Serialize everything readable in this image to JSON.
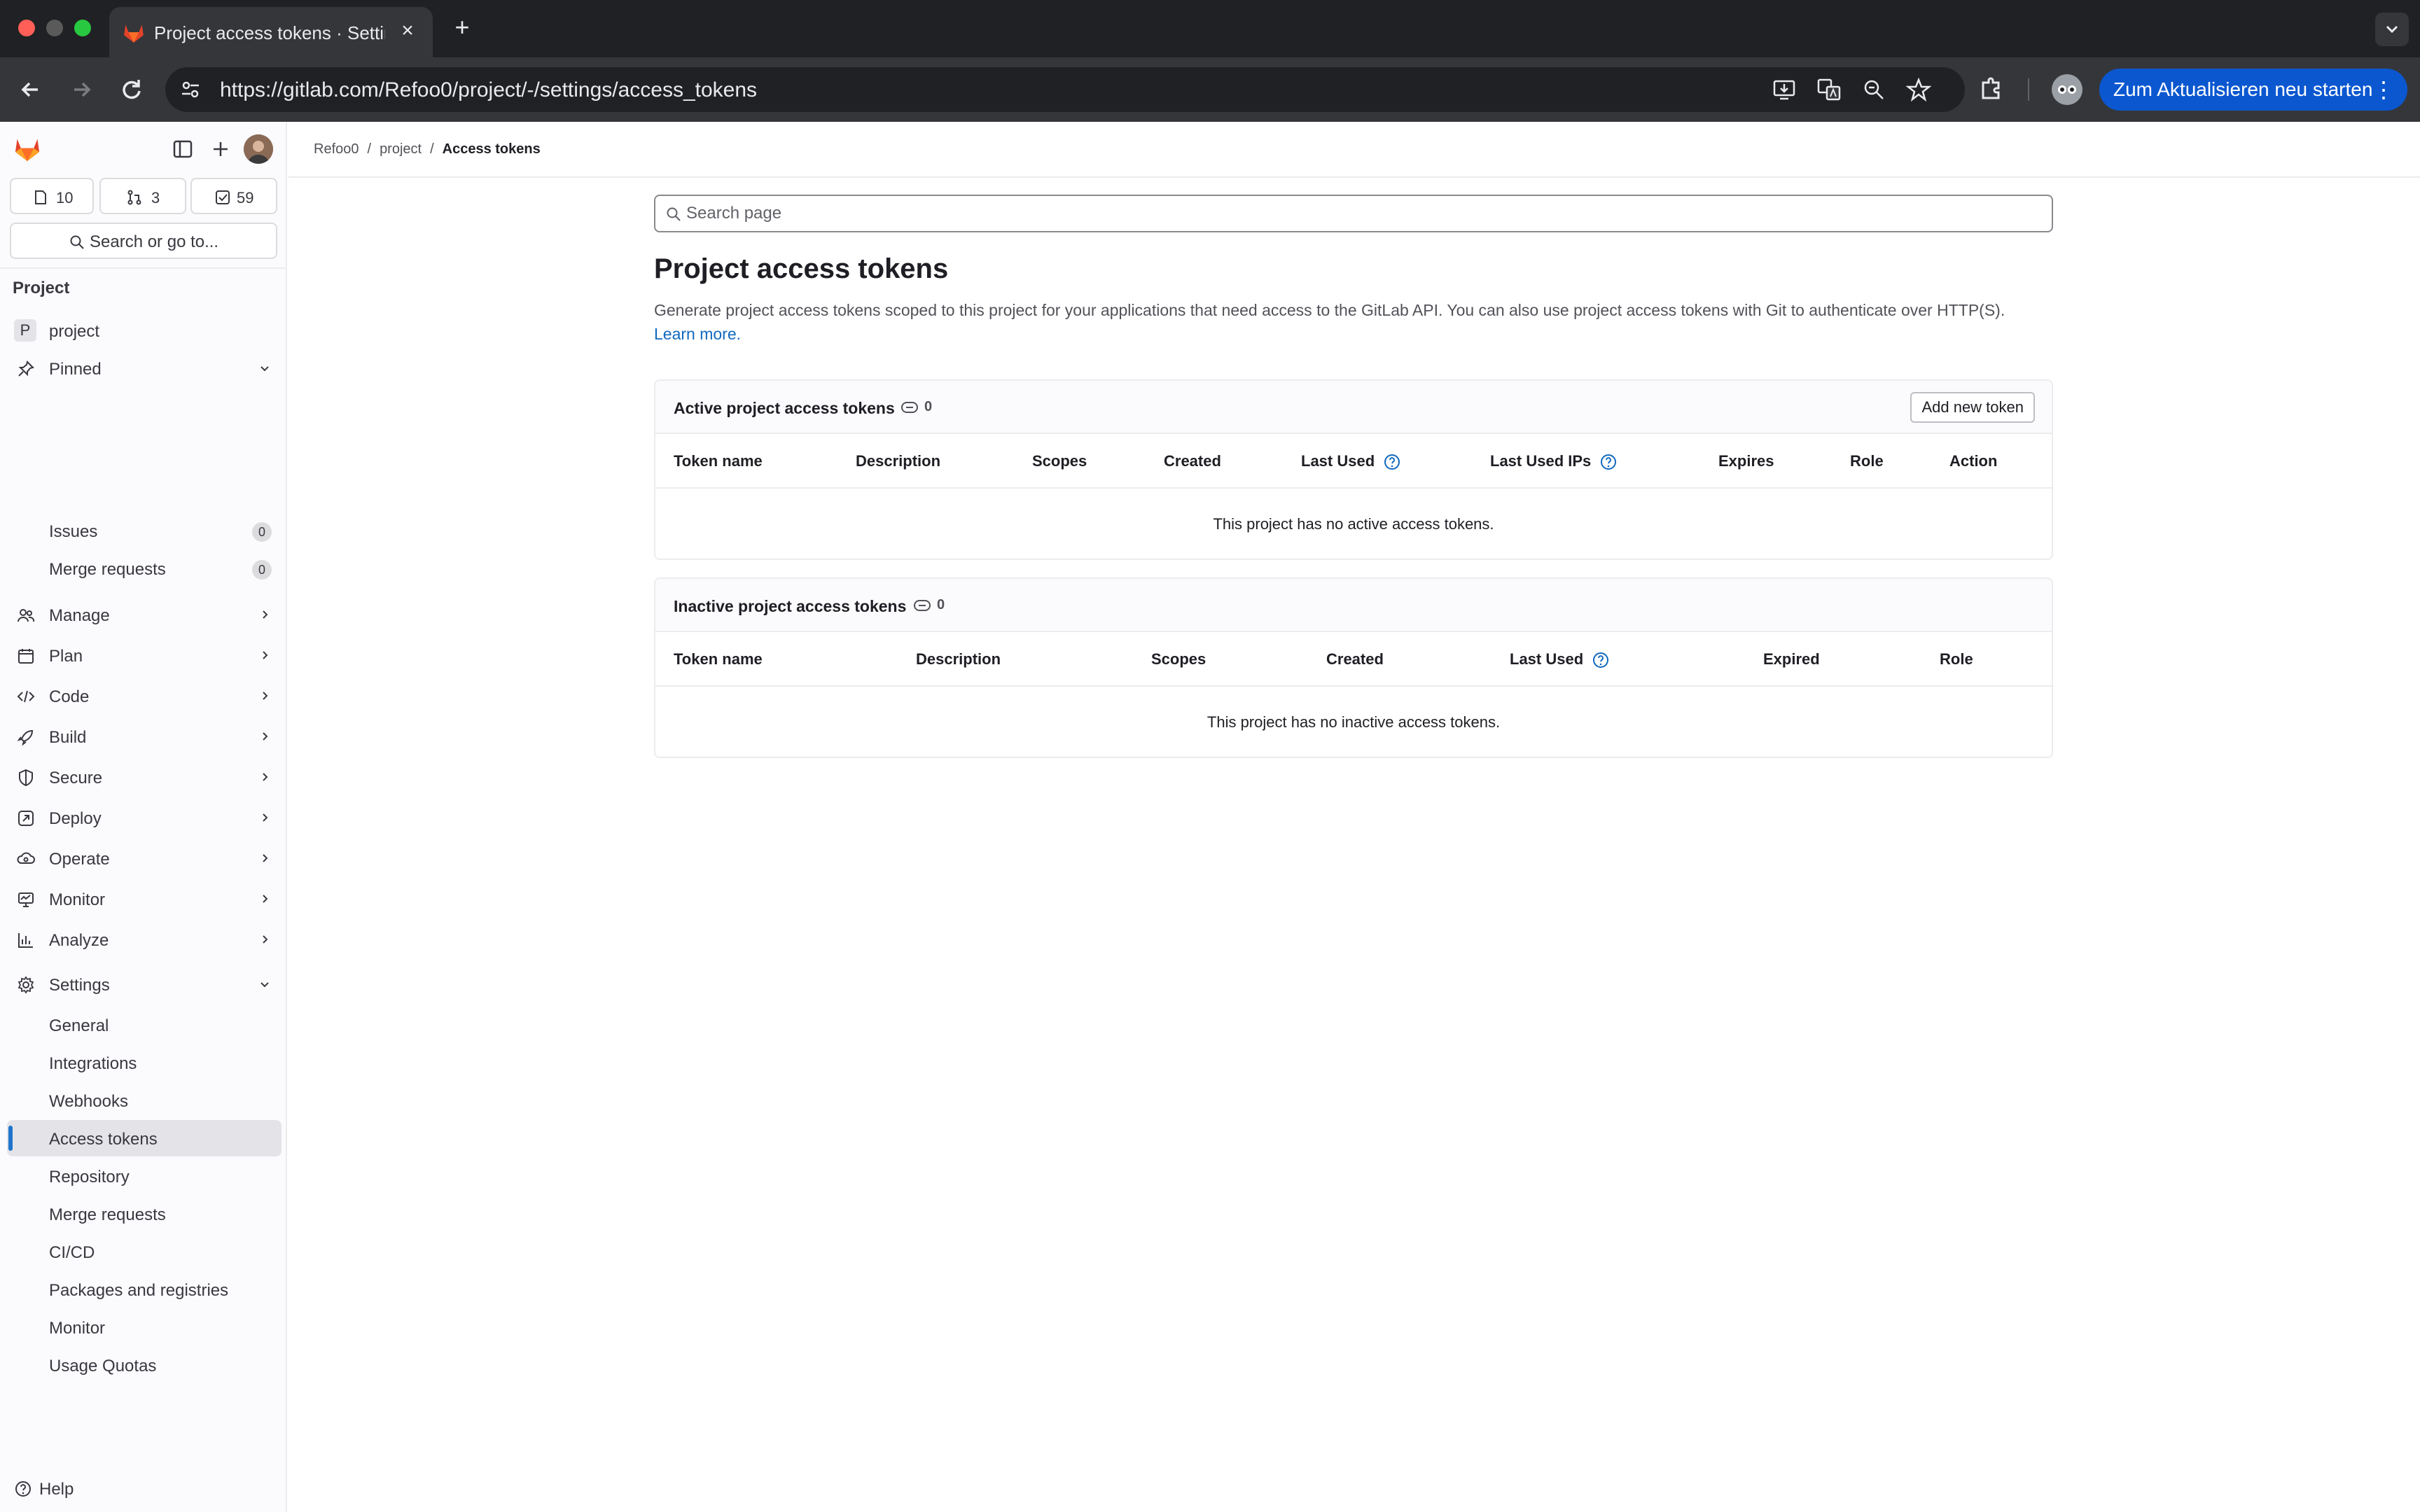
{
  "browser": {
    "tab_title": "Project access tokens · Settings · project · GitLab",
    "url": "https://gitlab.com/Refoo0/project/-/settings/access_tokens",
    "update_button": "Zum Aktualisieren neu starten"
  },
  "sidebar": {
    "counters": {
      "issues": "10",
      "merge_requests": "3",
      "todos": "59"
    },
    "search_label": "Search or go to...",
    "section_heading": "Project",
    "project": {
      "avatar_letter": "P",
      "name": "project"
    },
    "pinned": {
      "label": "Pinned",
      "issues": "Issues",
      "issues_count": "0",
      "mrs": "Merge requests",
      "mrs_count": "0"
    },
    "nav": {
      "manage": "Manage",
      "plan": "Plan",
      "code": "Code",
      "build": "Build",
      "secure": "Secure",
      "deploy": "Deploy",
      "operate": "Operate",
      "monitor": "Monitor",
      "analyze": "Analyze",
      "settings": "Settings"
    },
    "settings_items": {
      "general": "General",
      "integrations": "Integrations",
      "webhooks": "Webhooks",
      "access_tokens": "Access tokens",
      "repository": "Repository",
      "merge_requests": "Merge requests",
      "cicd": "CI/CD",
      "packages": "Packages and registries",
      "monitor": "Monitor",
      "usage_quotas": "Usage Quotas"
    },
    "help": "Help"
  },
  "breadcrumb": {
    "group": "Refoo0",
    "project": "project",
    "current": "Access tokens"
  },
  "main": {
    "search_placeholder": "Search page",
    "title": "Project access tokens",
    "description": "Generate project access tokens scoped to this project for your applications that need access to the GitLab API. You can also use project access tokens with Git to authenticate over HTTP(S).",
    "learn_more": "Learn more.",
    "active": {
      "title": "Active project access tokens",
      "count": "0",
      "add_button": "Add new token",
      "columns": {
        "token_name": "Token name",
        "description": "Description",
        "scopes": "Scopes",
        "created": "Created",
        "last_used": "Last Used",
        "last_used_ips": "Last Used IPs",
        "expires": "Expires",
        "role": "Role",
        "action": "Action"
      },
      "empty": "This project has no active access tokens."
    },
    "inactive": {
      "title": "Inactive project access tokens",
      "count": "0",
      "columns": {
        "token_name": "Token name",
        "description": "Description",
        "scopes": "Scopes",
        "created": "Created",
        "last_used": "Last Used",
        "expired": "Expired",
        "role": "Role"
      },
      "empty": "This project has no inactive access tokens."
    }
  },
  "colors": {
    "accent": "#1068bf",
    "active_indicator": "#1f75cb",
    "update_button": "#0b57d0",
    "gitlab_orange": "#e24329"
  }
}
